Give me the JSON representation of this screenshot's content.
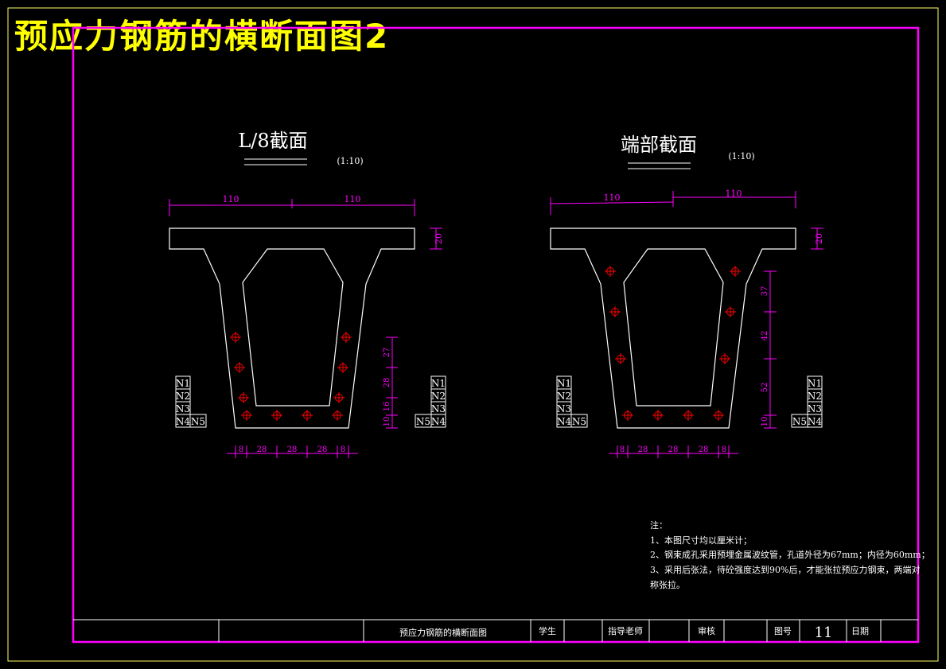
{
  "title": "预应力钢筋的横断面图2",
  "left_section": {
    "title": "L/8截面",
    "scale": "(1:10)",
    "top_dims": [
      "110",
      "110"
    ],
    "flange_dim": "20",
    "right_dims": [
      "27",
      "28",
      "16",
      "10"
    ],
    "bottom_dims": [
      "8",
      "28",
      "28",
      "28",
      "8"
    ],
    "tags_left": [
      "N1",
      "N2",
      "N3",
      "N4",
      "N5"
    ],
    "tags_right": [
      "N1",
      "N2",
      "N3",
      "N4",
      "N5"
    ]
  },
  "right_section": {
    "title": "端部截面",
    "scale": "(1:10)",
    "top_dims": [
      "110",
      "110"
    ],
    "flange_dim": "20",
    "right_dims": [
      "37",
      "42",
      "52",
      "10"
    ],
    "bottom_dims": [
      "8",
      "28",
      "28",
      "28",
      "8"
    ],
    "tags_left": [
      "N1",
      "N2",
      "N3",
      "N4",
      "N5"
    ],
    "tags_right": [
      "N1",
      "N2",
      "N3",
      "N4",
      "N5"
    ]
  },
  "notes": {
    "heading": "注：",
    "line1": "1、本图尺寸均以厘米计；",
    "line2": "2、钢束成孔采用预埋金属波纹管，孔道外径为67mm；内径为60mm；",
    "line3": "3、采用后张法，待砼强度达到90%后，才能张拉预应力钢束，两端对",
    "line4": "称张拉。"
  },
  "title_block": {
    "drawing_name": "预应力钢筋的横断面图",
    "student_label": "学生",
    "advisor_label": "指导老师",
    "review_label": "审核",
    "drawing_no_label": "图号",
    "drawing_no": "11",
    "date_label": "日期"
  },
  "colors": {
    "frame": "#ff00ff",
    "outline": "#ffffff",
    "dimension": "#ff00ff",
    "tendon": "#ff0000",
    "title": "#ffff00"
  }
}
